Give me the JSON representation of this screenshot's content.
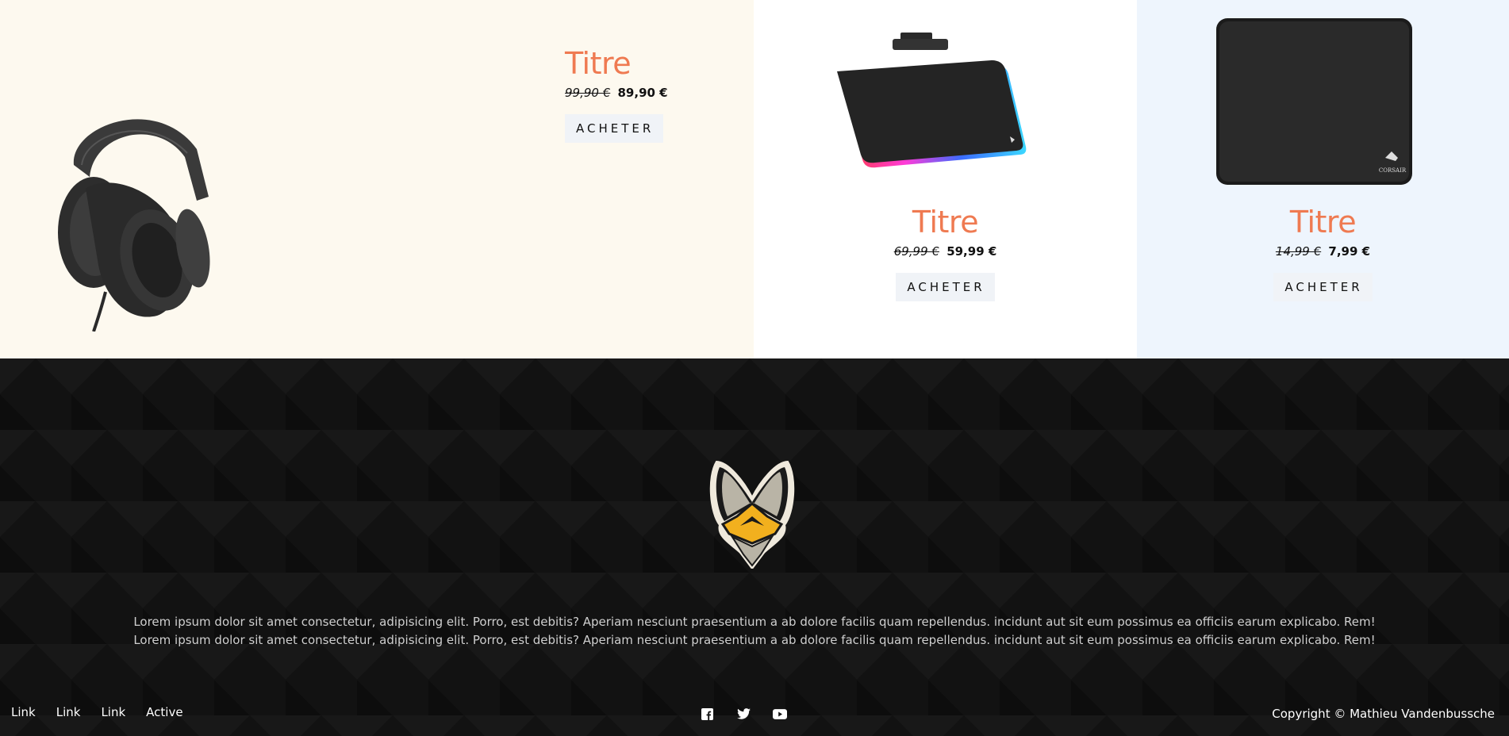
{
  "products": [
    {
      "title": "Titre",
      "old_price": "99,90 €",
      "price": "89,90 €",
      "button": "ACHETER",
      "image": "headset"
    },
    {
      "title": "Titre",
      "old_price": "69,99 €",
      "price": "59,99 €",
      "button": "ACHETER",
      "image": "rgb-mousepad"
    },
    {
      "title": "Titre",
      "old_price": "14,99 €",
      "price": "7,99 €",
      "button": "ACHETER",
      "image": "cloth-mousepad"
    }
  ],
  "footer": {
    "paragraph": [
      "Lorem ipsum dolor sit amet consectetur, adipisicing elit. Porro, est debitis? Aperiam nesciunt praesentium a ab dolore facilis quam repellendus. incidunt aut sit eum possimus ea officiis earum explicabo. Rem!",
      "Lorem ipsum dolor sit amet consectetur, adipisicing elit. Porro, est debitis? Aperiam nesciunt praesentium a ab dolore facilis quam repellendus. incidunt aut sit eum possimus ea officiis earum explicabo. Rem!"
    ],
    "links": [
      "Link",
      "Link",
      "Link",
      "Active"
    ],
    "social_icons": [
      "facebook-icon",
      "twitter-icon",
      "youtube-icon"
    ],
    "copyright": "Copyright © Mathieu Vandenbussche",
    "pad_brand": "CORSAIR"
  },
  "colors": {
    "accent": "#ef7a51",
    "card_cream": "#fdf9ef",
    "card_white": "#ffffff",
    "card_blue": "#eef5fd",
    "footer_bg": "#121212",
    "logo_gold": "#f2b01e"
  }
}
